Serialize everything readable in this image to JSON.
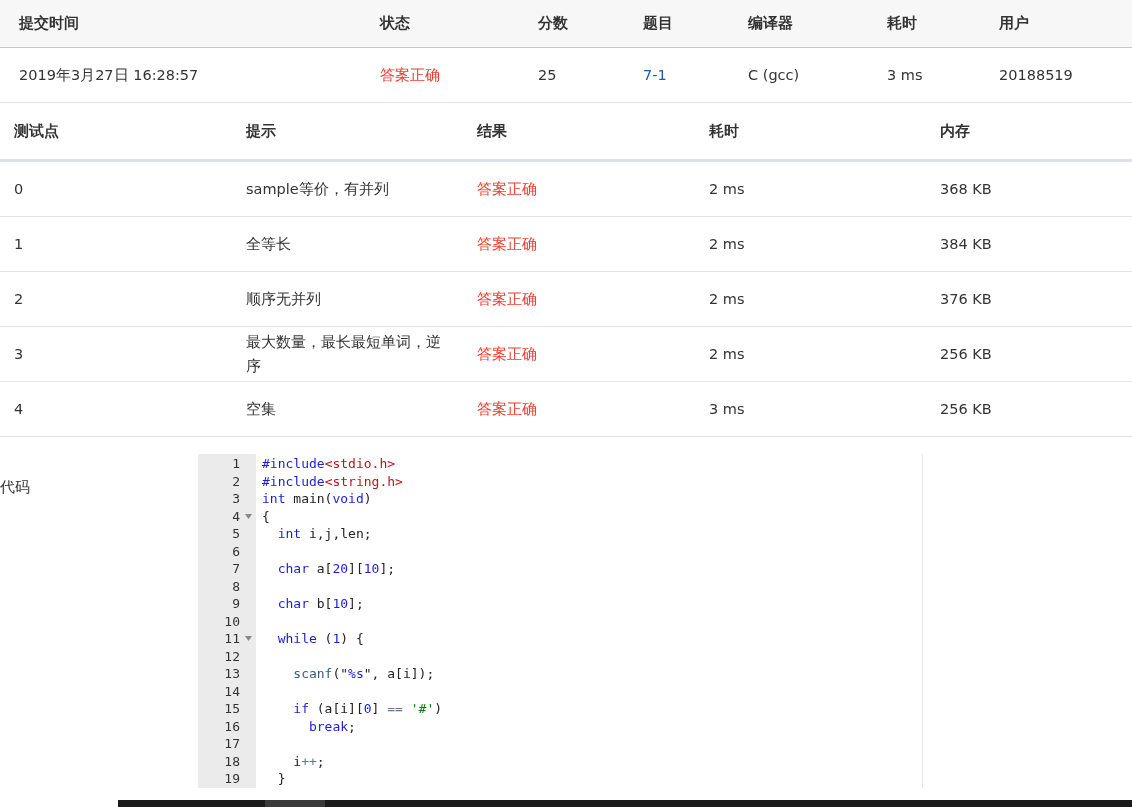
{
  "submission": {
    "columns": [
      "提交时间",
      "状态",
      "分数",
      "题目",
      "编译器",
      "耗时",
      "用户"
    ],
    "row": [
      {
        "kind": "text",
        "text": "2019年3月27日 16:28:57"
      },
      {
        "kind": "status",
        "text": "答案正确"
      },
      {
        "kind": "text",
        "text": "25"
      },
      {
        "kind": "link",
        "text": "7-1"
      },
      {
        "kind": "text",
        "text": "C (gcc)"
      },
      {
        "kind": "text",
        "text": "3 ms"
      },
      {
        "kind": "text",
        "text": "20188519"
      }
    ]
  },
  "tests": {
    "columns": [
      "测试点",
      "提示",
      "结果",
      "耗时",
      "内存"
    ],
    "rows": [
      {
        "id": "0",
        "hint": "sample等价，有并列",
        "result": "答案正确",
        "time": "2 ms",
        "memory": "368 KB"
      },
      {
        "id": "1",
        "hint": "全等长",
        "result": "答案正确",
        "time": "2 ms",
        "memory": "384 KB"
      },
      {
        "id": "2",
        "hint": "顺序无并列",
        "result": "答案正确",
        "time": "2 ms",
        "memory": "376 KB"
      },
      {
        "id": "3",
        "hint": "最大数量，最长最短单词，逆序",
        "result": "答案正确",
        "time": "2 ms",
        "memory": "256 KB"
      },
      {
        "id": "4",
        "hint": "空集",
        "result": "答案正确",
        "time": "3 ms",
        "memory": "256 KB"
      }
    ]
  },
  "code": {
    "label": "代码",
    "lines": [
      {
        "number": "1",
        "foldable": false,
        "tokens": [
          {
            "kind": "keyword",
            "text": "#include"
          },
          {
            "kind": "header",
            "text": "<stdio.h>"
          }
        ]
      },
      {
        "number": "2",
        "foldable": false,
        "tokens": [
          {
            "kind": "keyword",
            "text": "#include"
          },
          {
            "kind": "header",
            "text": "<string.h>"
          }
        ]
      },
      {
        "number": "3",
        "foldable": false,
        "tokens": [
          {
            "kind": "keyword",
            "text": "int"
          },
          {
            "kind": "plain",
            "text": " main("
          },
          {
            "kind": "keyword",
            "text": "void"
          },
          {
            "kind": "plain",
            "text": ")"
          }
        ]
      },
      {
        "number": "4",
        "foldable": true,
        "tokens": [
          {
            "kind": "plain",
            "text": "{"
          }
        ]
      },
      {
        "number": "5",
        "foldable": false,
        "tokens": [
          {
            "kind": "keyword",
            "text": "  int"
          },
          {
            "kind": "plain",
            "text": " i,j,len;"
          }
        ]
      },
      {
        "number": "6",
        "foldable": false
      },
      {
        "number": "7",
        "foldable": false,
        "tokens": [
          {
            "kind": "keyword",
            "text": "  char"
          },
          {
            "kind": "plain",
            "text": " a["
          },
          {
            "kind": "number",
            "text": "20"
          },
          {
            "kind": "plain",
            "text": "]["
          },
          {
            "kind": "number",
            "text": "10"
          },
          {
            "kind": "plain",
            "text": "];"
          }
        ]
      },
      {
        "number": "8",
        "foldable": false
      },
      {
        "number": "9",
        "foldable": false,
        "tokens": [
          {
            "kind": "keyword",
            "text": "  char"
          },
          {
            "kind": "plain",
            "text": " b["
          },
          {
            "kind": "number",
            "text": "10"
          },
          {
            "kind": "plain",
            "text": "];"
          }
        ]
      },
      {
        "number": "10",
        "foldable": false
      },
      {
        "number": "11",
        "foldable": true,
        "tokens": [
          {
            "kind": "keyword",
            "text": "  while"
          },
          {
            "kind": "plain",
            "text": " ("
          },
          {
            "kind": "number",
            "text": "1"
          },
          {
            "kind": "plain",
            "text": ") {"
          }
        ]
      },
      {
        "number": "12",
        "foldable": false
      },
      {
        "number": "13",
        "foldable": false,
        "tokens": [
          {
            "kind": "function",
            "text": "    scanf"
          },
          {
            "kind": "plain",
            "text": "(\""
          },
          {
            "kind": "number",
            "text": "%s"
          },
          {
            "kind": "plain",
            "text": "\", a[i]);"
          }
        ]
      },
      {
        "number": "14",
        "foldable": false
      },
      {
        "number": "15",
        "foldable": false,
        "tokens": [
          {
            "kind": "keyword",
            "text": "    if"
          },
          {
            "kind": "plain",
            "text": " (a[i]["
          },
          {
            "kind": "number",
            "text": "0"
          },
          {
            "kind": "plain",
            "text": "] "
          },
          {
            "kind": "operator",
            "text": "=="
          },
          {
            "kind": "string",
            "text": " '#'"
          },
          {
            "kind": "plain",
            "text": ")"
          }
        ]
      },
      {
        "number": "16",
        "foldable": false,
        "tokens": [
          {
            "kind": "keyword",
            "text": "      break"
          },
          {
            "kind": "plain",
            "text": ";"
          }
        ]
      },
      {
        "number": "17",
        "foldable": false
      },
      {
        "number": "18",
        "foldable": false,
        "tokens": [
          {
            "kind": "plain",
            "text": "    i"
          },
          {
            "kind": "operator",
            "text": "++"
          },
          {
            "kind": "plain",
            "text": ";"
          }
        ]
      },
      {
        "number": "19",
        "foldable": false,
        "tokens": [
          {
            "kind": "plain",
            "text": "  }"
          }
        ]
      }
    ]
  }
}
